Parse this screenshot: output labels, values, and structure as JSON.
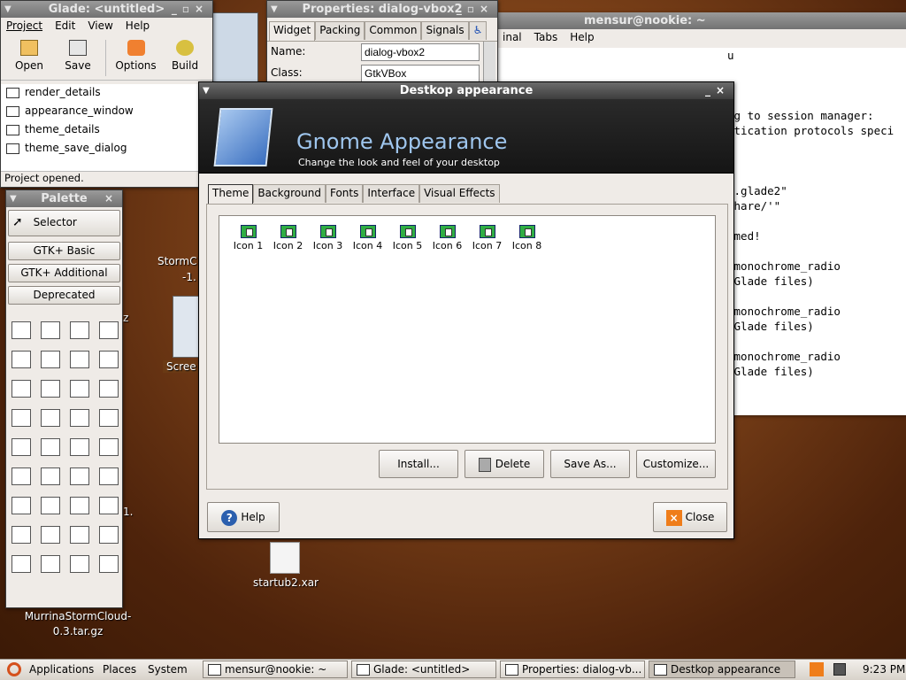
{
  "terminal": {
    "title": "mensur@nookie: ~",
    "menu": [
      "inal",
      "Tabs",
      "Help"
    ],
    "lines": [
      "u",
      "",
      "",
      "",
      "ng to session manager:",
      "ntication protocols speci",
      "",
      "",
      "",
      "'.glade2\"",
      "share/'\"",
      "",
      "rmed!",
      "",
      " monochrome_radio",
      " Glade files)",
      "",
      " monochrome_radio",
      " Glade files)",
      "",
      " monochrome_radio",
      " Glade files)"
    ]
  },
  "glade": {
    "title": "Glade: <untitled>",
    "menu": [
      "Project",
      "Edit",
      "View",
      "Help"
    ],
    "toolbar": [
      "Open",
      "Save",
      "Options",
      "Build"
    ],
    "windows": [
      "render_details",
      "appearance_window",
      "theme_details",
      "theme_save_dialog"
    ],
    "status": "Project opened."
  },
  "properties": {
    "title": "Properties: dialog-vbox2",
    "tabs": [
      "Widget",
      "Packing",
      "Common",
      "Signals"
    ],
    "name_label": "Name:",
    "name_value": "dialog-vbox2",
    "class_label": "Class:",
    "class_value": "GtkVBox"
  },
  "palette": {
    "title": "Palette",
    "selector": "Selector",
    "groups": [
      "GTK+ Basic",
      "GTK+ Additional",
      "Deprecated"
    ]
  },
  "desktop": {
    "icons": [
      "StormC",
      "-1.",
      "Scree",
      "z",
      "1.",
      "startub2.xar",
      "MurrinaStormCloud-",
      "0.3.tar.gz"
    ]
  },
  "dialog": {
    "title": "Destkop appearance",
    "banner_title": "Gnome Appearance",
    "banner_subtitle": "Change the look and feel of your desktop",
    "tabs": [
      "Theme",
      "Background",
      "Fonts",
      "Interface",
      "Visual Effects"
    ],
    "active_tab": "Theme",
    "theme_icons": [
      "Icon 1",
      "Icon 2",
      "Icon 3",
      "Icon 4",
      "Icon 5",
      "Icon 6",
      "Icon 7",
      "Icon 8"
    ],
    "buttons": {
      "install": "Install...",
      "delete": "Delete",
      "save_as": "Save As...",
      "customize": "Customize..."
    },
    "help": "Help",
    "close": "Close"
  },
  "taskbar": {
    "menus": [
      "Applications",
      "Places",
      "System"
    ],
    "tasks": [
      "mensur@nookie: ~",
      "Glade: <untitled>",
      "Properties: dialog-vb...",
      "Destkop appearance"
    ],
    "clock": "9:23 PM"
  },
  "colors": {
    "accent": "#ef7d1a",
    "titlebar": "#3d3d3d",
    "banner": "#1e1e1e",
    "banner_text": "#9fc6ee"
  }
}
